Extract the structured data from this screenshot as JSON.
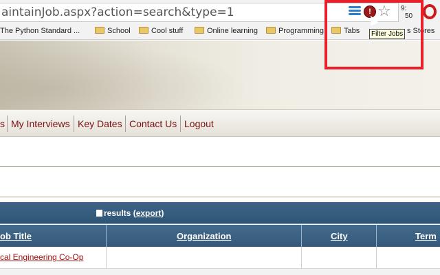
{
  "browser": {
    "url": "aintainJob.aspx?action=search&type=1",
    "clock": {
      "hour": "9:",
      "minute": "50"
    },
    "extension_badge": "!",
    "tooltip": "Filter Jobs",
    "bookmarks": [
      {
        "label": "The Python Standard ...",
        "type": "page"
      },
      {
        "label": "School",
        "type": "folder"
      },
      {
        "label": "Cool stuff",
        "type": "folder"
      },
      {
        "label": "Online learning",
        "type": "folder"
      },
      {
        "label": "Programming",
        "type": "folder"
      },
      {
        "label": "Tabs",
        "type": "folder"
      },
      {
        "label": "s Stores",
        "type": "page"
      }
    ]
  },
  "nav": {
    "items": [
      "s",
      "My Interviews",
      "Key Dates",
      "Contact Us",
      "Logout"
    ]
  },
  "results": {
    "label": "results",
    "export_open": "(",
    "export_label": "export",
    "export_close": ")"
  },
  "table": {
    "columns": [
      "ob Title",
      "Organization",
      "City",
      "Term"
    ],
    "rows": [
      {
        "title": "cal Engineering Co-Op",
        "organization": "",
        "city": "",
        "term": ""
      }
    ]
  },
  "colors": {
    "nav_link": "#7a1010",
    "table_header": "#3d6386",
    "highlight": "#e8202a"
  }
}
